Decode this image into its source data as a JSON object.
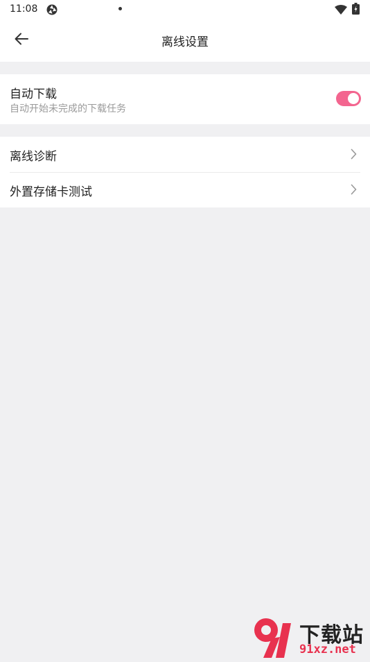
{
  "status_bar": {
    "time": "11:08",
    "icons": [
      "aperture-icon",
      "notification-dot-icon",
      "wifi-icon",
      "battery-icon"
    ]
  },
  "header": {
    "title": "离线设置",
    "back_icon": "arrow-left-icon"
  },
  "auto_download": {
    "title": "自动下载",
    "subtitle": "自动开始未完成的下载任务",
    "enabled": true,
    "accent_color": "#f3658f"
  },
  "menu": {
    "items": [
      {
        "label": "离线诊断",
        "icon": "chevron-right-icon"
      },
      {
        "label": "外置存储卡测试",
        "icon": "chevron-right-icon"
      }
    ]
  },
  "watermark": {
    "brand": "下载站",
    "url": "91xz.net",
    "logo_mark": "9"
  },
  "colors": {
    "background": "#f0f0f2",
    "surface": "#ffffff",
    "text_primary": "#222222",
    "text_secondary": "#9a9a9a",
    "brand_red": "#e8324f"
  }
}
